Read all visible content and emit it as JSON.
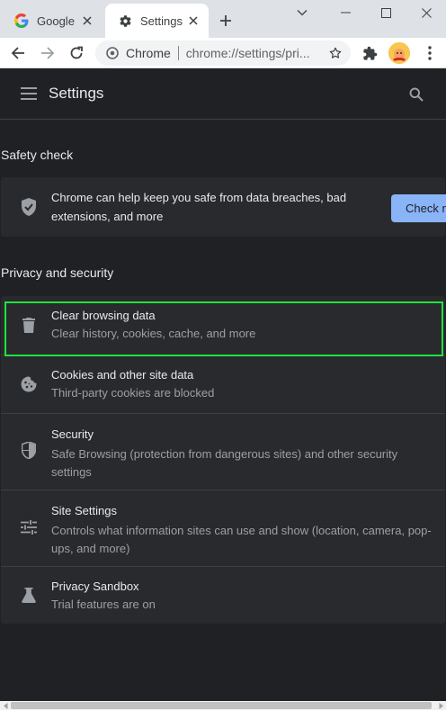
{
  "browser": {
    "tabs": [
      {
        "title": "Google",
        "icon": "google-icon",
        "active": false
      },
      {
        "title": "Settings",
        "icon": "gear-icon",
        "active": true
      }
    ],
    "omnibox": {
      "site_name": "Chrome",
      "url": "chrome://settings/pri..."
    }
  },
  "settings": {
    "header_title": "Settings",
    "safety_check": {
      "section_title": "Safety check",
      "description": "Chrome can help keep you safe from data breaches, bad extensions, and more",
      "button_label": "Check n"
    },
    "privacy": {
      "section_title": "Privacy and security",
      "items": [
        {
          "icon": "trash-icon",
          "title": "Clear browsing data",
          "subtitle": "Clear history, cookies, cache, and more"
        },
        {
          "icon": "cookie-icon",
          "title": "Cookies and other site data",
          "subtitle": "Third-party cookies are blocked"
        },
        {
          "icon": "shield-icon",
          "title": "Security",
          "subtitle": "Safe Browsing (protection from dangerous sites) and other security settings"
        },
        {
          "icon": "sliders-icon",
          "title": "Site Settings",
          "subtitle": "Controls what information sites can use and show (location, camera, pop-ups, and more)"
        },
        {
          "icon": "flask-icon",
          "title": "Privacy Sandbox",
          "subtitle": "Trial features are on"
        }
      ]
    }
  },
  "colors": {
    "background": "#202124",
    "card": "#292a2d",
    "accent": "#8ab4f8",
    "highlight": "#1fe23f"
  }
}
